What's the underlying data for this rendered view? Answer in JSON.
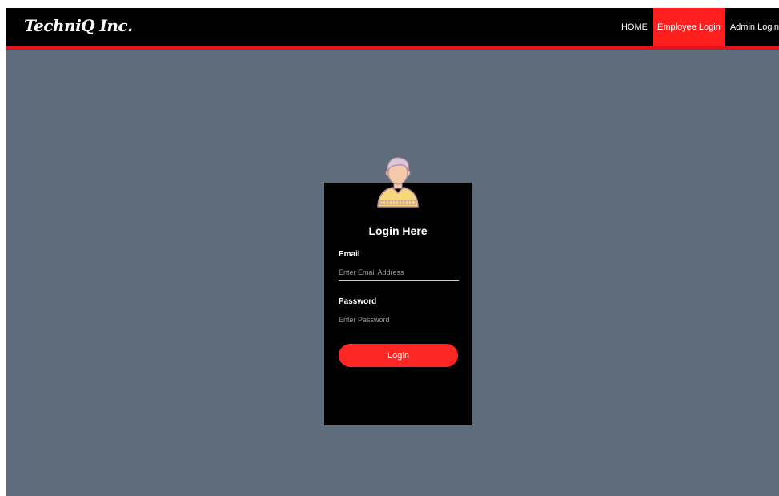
{
  "navbar": {
    "brand": "TechniQ Inc.",
    "links": [
      {
        "label": "HOME",
        "active": false
      },
      {
        "label": "Employee Login",
        "active": true
      },
      {
        "label": "Admin Login",
        "active": false
      }
    ]
  },
  "login": {
    "title": "Login Here",
    "email_label": "Email",
    "email_placeholder": "Enter Email Address",
    "email_value": "",
    "password_label": "Password",
    "password_placeholder": "Enter Password",
    "password_value": "",
    "button_label": "Login",
    "avatar_icon": "user-avatar-icon"
  },
  "colors": {
    "background": "#5f6c7b",
    "navbar": "#000000",
    "accent": "#ff1f1f",
    "card": "#000000"
  }
}
